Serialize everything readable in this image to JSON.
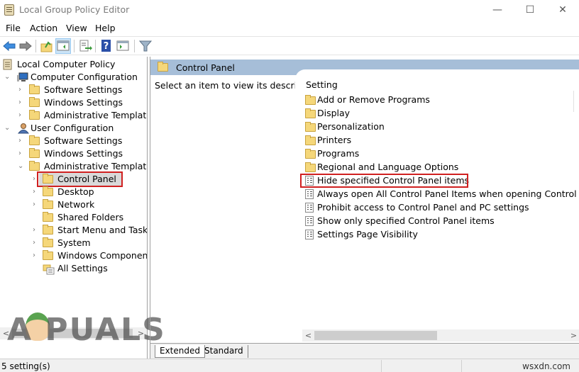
{
  "window": {
    "title": "Local Group Policy Editor",
    "controls": {
      "minimize": "—",
      "maximize": "☐",
      "close": "✕"
    }
  },
  "menu": [
    "File",
    "Action",
    "View",
    "Help"
  ],
  "toolbar": {
    "buttons": [
      {
        "name": "back",
        "icon": "←"
      },
      {
        "name": "forward",
        "icon": "→"
      },
      {
        "name": "up-folder",
        "icon": "↑"
      },
      {
        "name": "show-hide-console-tree",
        "icon": "▤",
        "active": true
      },
      {
        "name": "export-list",
        "icon": "⇨"
      },
      {
        "name": "help",
        "icon": "?"
      },
      {
        "name": "show-hide-action-pane",
        "icon": "▥"
      },
      {
        "name": "filter",
        "icon": "▼"
      }
    ]
  },
  "tree": {
    "root": "Local Computer Policy",
    "computer_config": "Computer Configuration",
    "user_config": "User Configuration",
    "cc_children": [
      "Software Settings",
      "Windows Settings",
      "Administrative Templates"
    ],
    "uc_children": [
      "Software Settings",
      "Windows Settings",
      "Administrative Templates"
    ],
    "admin_templates_children": [
      "Control Panel",
      "Desktop",
      "Network",
      "Shared Folders",
      "Start Menu and Taskbar",
      "System",
      "Windows Components",
      "All Settings"
    ],
    "selected": "Control Panel"
  },
  "content": {
    "header": "Control Panel",
    "description": "Select an item to view its description.",
    "column_header": "Setting",
    "folders": [
      "Add or Remove Programs",
      "Display",
      "Personalization",
      "Printers",
      "Programs",
      "Regional and Language Options"
    ],
    "policies": [
      "Hide specified Control Panel items",
      "Always open All Control Panel Items when opening Control Panel",
      "Prohibit access to Control Panel and PC settings",
      "Show only specified Control Panel items",
      "Settings Page Visibility"
    ],
    "highlighted_policy": "Hide specified Control Panel items"
  },
  "tabs": [
    "Extended",
    "Standard"
  ],
  "active_tab": "Extended",
  "status": {
    "text": "5 setting(s)",
    "watermark_site": "wsxdn.com"
  },
  "watermark": "A  PUALS",
  "scroll": {
    "left": "<",
    "right": ">"
  }
}
